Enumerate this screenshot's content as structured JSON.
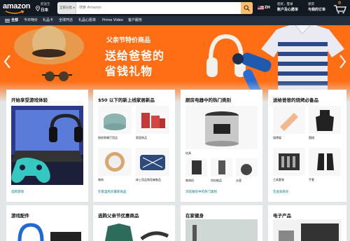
{
  "header": {
    "logo_text": "amazon",
    "deliver_top": "配送至",
    "deliver_bottom": "日本",
    "search_category": "全部分类",
    "search_placeholder": "搜索 Amazon",
    "language": "ZH",
    "account_top": "您好，登录",
    "account_bottom": "账户及心愿单",
    "orders_top": "退货",
    "orders_bottom": "与我的订单",
    "cart_count": "0"
  },
  "nav": {
    "all": "全部",
    "items": [
      "今日特价",
      "礼品卡",
      "全球开店",
      "礼品心愿单",
      "Prime Video",
      "客户服务"
    ]
  },
  "hero": {
    "subtitle": "父亲节特价商品",
    "title_line1": "送给爸爸的",
    "title_line2": "省钱礼物"
  },
  "cards": [
    {
      "title": "开始享受游戏体验",
      "link": "选购游戏"
    },
    {
      "title": "$50 以下的新上线家居新品",
      "tiles": [
        "厨房和餐厅用品",
        "家居饰品",
        "装饰",
        "床上用品和亚麻制品"
      ],
      "link": "在家里购买最新商品"
    },
    {
      "title": "厨房电器中的热门类别",
      "tiles": [
        "炊具",
        "咖啡机",
        "饮料制品",
        "水壶"
      ],
      "link": "浏览厨房中的热门类别"
    },
    {
      "title": "送给爸爸的烧烤必备品",
      "tiles": [
        "烧烤架",
        "围裙",
        "工具套装",
        "手套"
      ],
      "link": "在此处购买"
    },
    {
      "title": "游戏配件"
    },
    {
      "title": "选购父亲节优惠商品"
    },
    {
      "title": "在家健身"
    },
    {
      "title": "电子产品"
    }
  ],
  "colors": {
    "header_bg": "#131921",
    "nav_bg": "#232f3e",
    "hero_orange": "#ff6e14",
    "search_button": "#febd69",
    "link": "#007185"
  }
}
